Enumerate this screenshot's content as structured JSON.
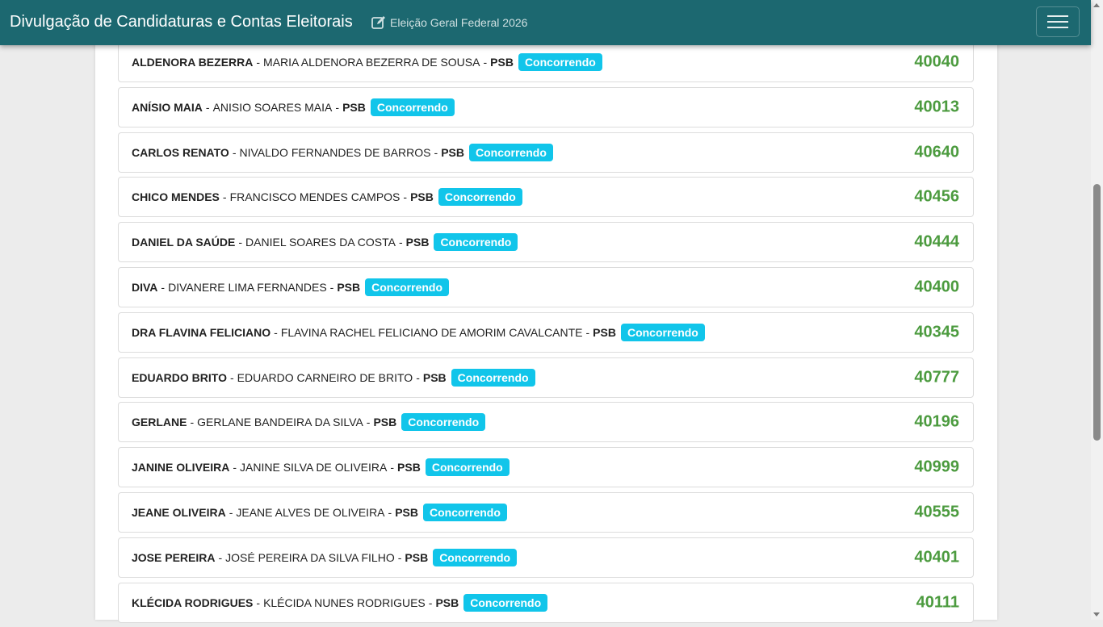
{
  "header": {
    "title": "Divulgação de Candidaturas e Contas Eleitorais",
    "election": "Eleição Geral Federal 2026",
    "edit_icon": "edit-icon",
    "menu_icon": "hamburger-menu-icon"
  },
  "colors": {
    "navbar": "#1c6870",
    "badge": "#11c5ea",
    "number": "#4c9b3f"
  },
  "candidates": [
    {
      "nick": "ALDENORA BEZERRA",
      "name": "MARIA ALDENORA BEZERRA DE SOUSA",
      "party": "PSB",
      "status": "Concorrendo",
      "number": "40040"
    },
    {
      "nick": "ANÍSIO MAIA",
      "name": "ANISIO SOARES MAIA",
      "party": "PSB",
      "status": "Concorrendo",
      "number": "40013"
    },
    {
      "nick": "CARLOS RENATO",
      "name": "NIVALDO FERNANDES DE BARROS",
      "party": "PSB",
      "status": "Concorrendo",
      "number": "40640"
    },
    {
      "nick": "CHICO MENDES",
      "name": "FRANCISCO MENDES CAMPOS",
      "party": "PSB",
      "status": "Concorrendo",
      "number": "40456"
    },
    {
      "nick": "DANIEL DA SAÚDE",
      "name": "DANIEL SOARES DA COSTA",
      "party": "PSB",
      "status": "Concorrendo",
      "number": "40444"
    },
    {
      "nick": "DIVA",
      "name": "DIVANERE LIMA FERNANDES",
      "party": "PSB",
      "status": "Concorrendo",
      "number": "40400"
    },
    {
      "nick": "DRA FLAVINA FELICIANO",
      "name": "FLAVINA RACHEL FELICIANO DE AMORIM CAVALCANTE",
      "party": "PSB",
      "status": "Concorrendo",
      "number": "40345"
    },
    {
      "nick": "EDUARDO BRITO",
      "name": "EDUARDO CARNEIRO DE BRITO",
      "party": "PSB",
      "status": "Concorrendo",
      "number": "40777"
    },
    {
      "nick": "GERLANE",
      "name": "GERLANE BANDEIRA DA SILVA",
      "party": "PSB",
      "status": "Concorrendo",
      "number": "40196"
    },
    {
      "nick": "JANINE OLIVEIRA",
      "name": "JANINE SILVA DE OLIVEIRA",
      "party": "PSB",
      "status": "Concorrendo",
      "number": "40999"
    },
    {
      "nick": "JEANE OLIVEIRA",
      "name": "JEANE ALVES DE OLIVEIRA",
      "party": "PSB",
      "status": "Concorrendo",
      "number": "40555"
    },
    {
      "nick": "JOSE PEREIRA",
      "name": "JOSÉ PEREIRA DA SILVA FILHO",
      "party": "PSB",
      "status": "Concorrendo",
      "number": "40401"
    },
    {
      "nick": "KLÉCIDA RODRIGUES",
      "name": "KLÉCIDA NUNES RODRIGUES",
      "party": "PSB",
      "status": "Concorrendo",
      "number": "40111"
    }
  ]
}
